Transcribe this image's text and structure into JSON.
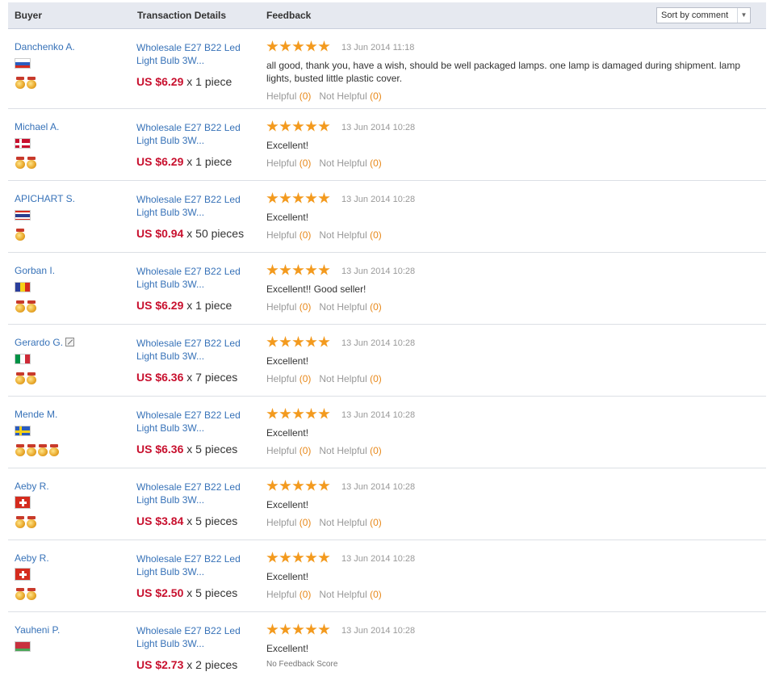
{
  "header": {
    "buyer": "Buyer",
    "transaction": "Transaction Details",
    "feedback": "Feedback",
    "sort_value": "Sort by comment"
  },
  "colors": {
    "link": "#3772b8",
    "price": "#c8102e",
    "star": "#f39a1e",
    "count": "#e8891b"
  },
  "helpful_label": "Helpful",
  "not_helpful_label": "Not Helpful",
  "rows": [
    {
      "buyer": "Danchenko A.",
      "flag": "flag-russia",
      "medals": 2,
      "product": "Wholesale E27 B22 Led Light Bulb 3W...",
      "price": "US $6.29",
      "qty": "x 1 piece",
      "date": "13 Jun 2014 11:18",
      "comment": "all good, thank you, have a wish, should be well packaged lamps. one lamp is damaged during shipment. lamp lights, busted little plastic cover.",
      "helpful_count": "(0)",
      "not_helpful_count": "(0)"
    },
    {
      "buyer": "Michael A.",
      "flag": "flag-denmark",
      "medals": 2,
      "product": "Wholesale E27 B22 Led Light Bulb 3W...",
      "price": "US $6.29",
      "qty": "x 1 piece",
      "date": "13 Jun 2014 10:28",
      "comment": "Excellent!",
      "helpful_count": "(0)",
      "not_helpful_count": "(0)"
    },
    {
      "buyer": "APICHART S.",
      "flag": "flag-thailand",
      "medals": 1,
      "product": "Wholesale E27 B22 Led Light Bulb 3W...",
      "price": "US $0.94",
      "qty": "x 50 pieces",
      "date": "13 Jun 2014 10:28",
      "comment": "Excellent!",
      "helpful_count": "(0)",
      "not_helpful_count": "(0)"
    },
    {
      "buyer": "Gorban I.",
      "flag": "flag-romania",
      "medals": 2,
      "product": "Wholesale E27 B22 Led Light Bulb 3W...",
      "price": "US $6.29",
      "qty": "x 1 piece",
      "date": "13 Jun 2014 10:28",
      "comment": "Excellent!! Good seller!",
      "helpful_count": "(0)",
      "not_helpful_count": "(0)"
    },
    {
      "buyer": "Gerardo G.",
      "flag": "flag-italy",
      "medals": 2,
      "product": "Wholesale E27 B22 Led Light Bulb 3W...",
      "price": "US $6.36",
      "qty": "x 7 pieces",
      "date": "13 Jun 2014 10:28",
      "comment": "Excellent!",
      "helpful_count": "(0)",
      "not_helpful_count": "(0)"
    },
    {
      "buyer": "Mende M.",
      "flag": "flag-sweden",
      "medals": 4,
      "product": "Wholesale E27 B22 Led Light Bulb 3W...",
      "price": "US $6.36",
      "qty": "x 5 pieces",
      "date": "13 Jun 2014 10:28",
      "comment": "Excellent!",
      "helpful_count": "(0)",
      "not_helpful_count": "(0)"
    },
    {
      "buyer": "Aeby R.",
      "flag": "flag-switzerland",
      "medals": 2,
      "product": "Wholesale E27 B22 Led Light Bulb 3W...",
      "price": "US $3.84",
      "qty": "x 5 pieces",
      "date": "13 Jun 2014 10:28",
      "comment": "Excellent!",
      "helpful_count": "(0)",
      "not_helpful_count": "(0)"
    },
    {
      "buyer": "Aeby R.",
      "flag": "flag-switzerland",
      "medals": 2,
      "product": "Wholesale E27 B22 Led Light Bulb 3W...",
      "price": "US $2.50",
      "qty": "x 5 pieces",
      "date": "13 Jun 2014 10:28",
      "comment": "Excellent!",
      "helpful_count": "(0)",
      "not_helpful_count": "(0)"
    },
    {
      "buyer": "Yauheni P.",
      "flag": "flag-belarus",
      "medals": 0,
      "product": "Wholesale E27 B22 Led Light Bulb 3W...",
      "price": "US $2.73",
      "qty": "x 2 pieces",
      "date": "13 Jun 2014 10:28",
      "comment": "Excellent!",
      "no_feedback": "No Feedback Score"
    }
  ]
}
